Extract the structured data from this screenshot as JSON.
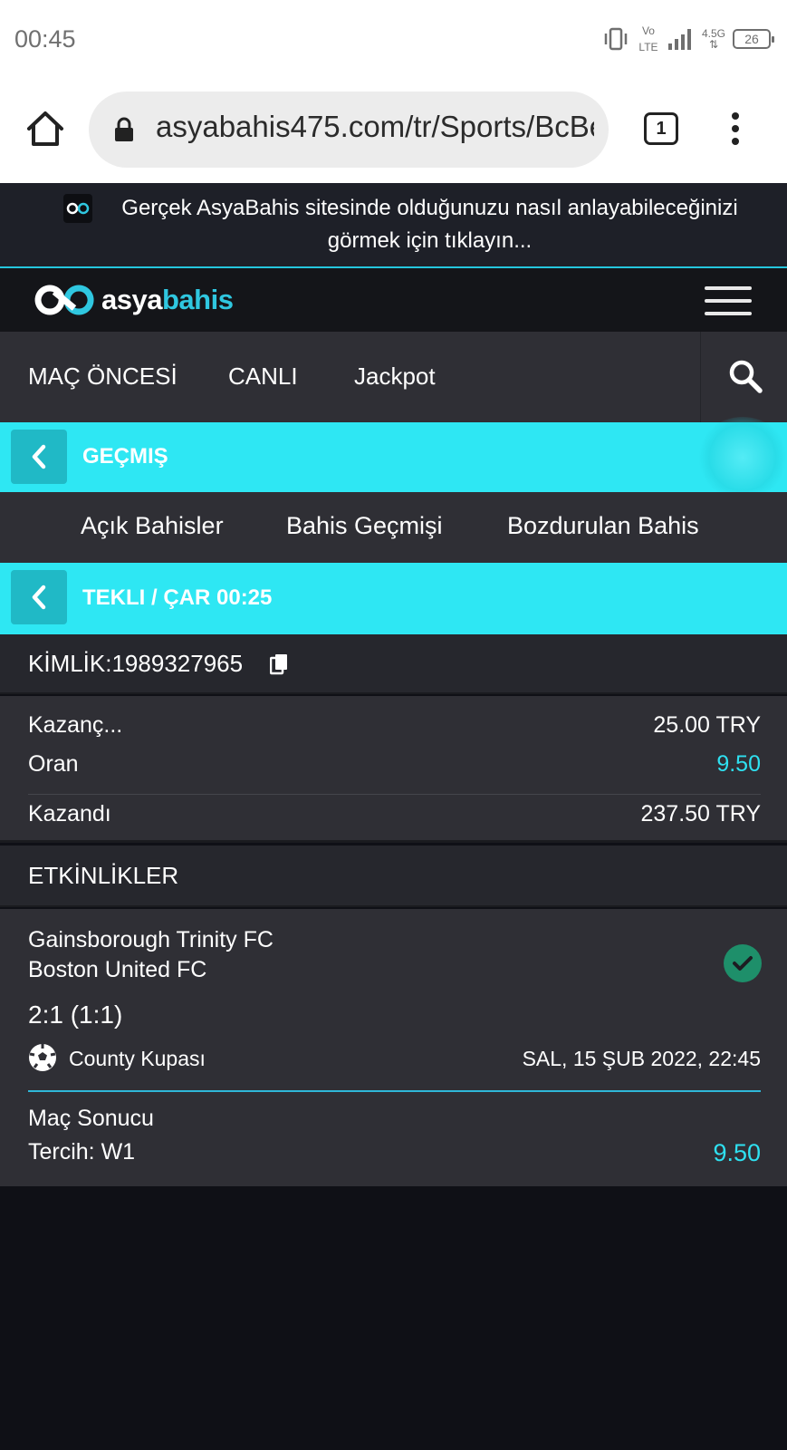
{
  "status_bar": {
    "time": "00:45",
    "network": "4.5G",
    "volte": "Vo LTE",
    "battery": "26"
  },
  "browser": {
    "url": "asyabahis475.com/tr/Sports/BcBets",
    "tab_count": "1"
  },
  "banner": {
    "text": "Gerçek AsyaBahis sitesinde olduğunuzu nasıl anlayabileceğinizi görmek için tıklayın..."
  },
  "header": {
    "brand_part1": "asya",
    "brand_part2": "bahis"
  },
  "nav": {
    "items": [
      "MAÇ ÖNCESİ",
      "CANLI",
      "Jackpot"
    ]
  },
  "history_bar": {
    "title": "GEÇMIŞ"
  },
  "subtabs": {
    "items": [
      "Açık Bahisler",
      "Bahis Geçmişi",
      "Bozdurulan Bahis"
    ]
  },
  "bet_bar": {
    "title": "TEKLI / ÇAR 00:25"
  },
  "bet": {
    "id_label": "KİMLİK:1989327965",
    "stake_label": "Kazanç...",
    "stake_value": "25.00 TRY",
    "odds_label": "Oran",
    "odds_value": "9.50",
    "won_label": "Kazandı",
    "won_value": "237.50 TRY"
  },
  "events": {
    "heading": "ETKİNLİKLER",
    "items": [
      {
        "home": "Gainsborough Trinity FC",
        "away": "Boston United FC",
        "score": "2:1 (1:1)",
        "league": "County Kupası",
        "date": "SAL, 15 ŞUB 2022, 22:45",
        "market": "Maç Sonucu",
        "pick": "Tercih: W1",
        "odds": "9.50",
        "status": "won"
      }
    ]
  },
  "colors": {
    "accent_cyan": "#2ee7f3",
    "odds_cyan": "#2fe0f0",
    "won_green": "#1e8f6a",
    "panel": "#2f2f35",
    "background": "#0f1016"
  }
}
